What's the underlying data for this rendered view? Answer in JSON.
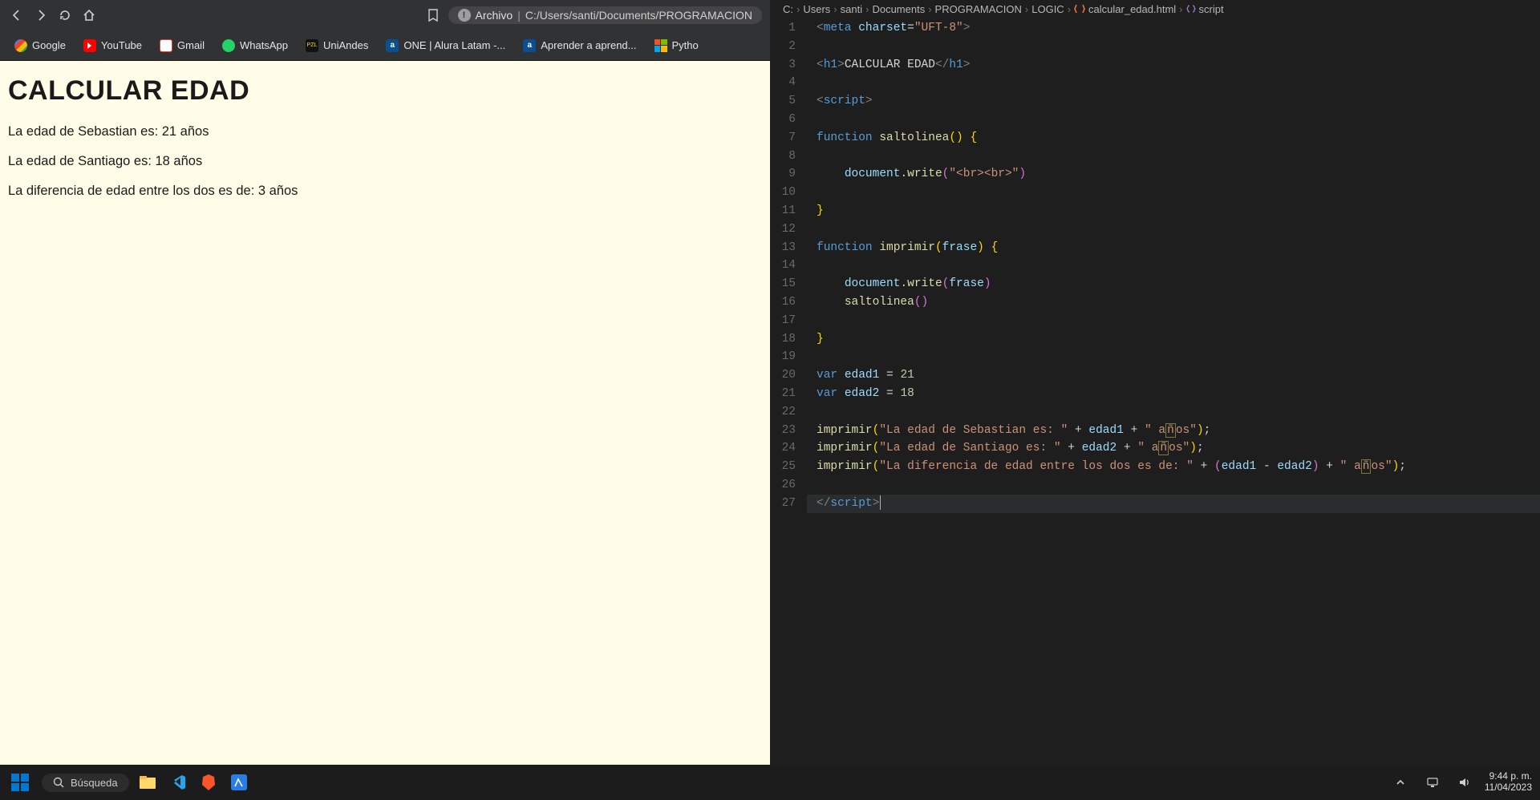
{
  "browser": {
    "url_label": "Archivo",
    "url_path": "C:/Users/santi/Documents/PROGRAMACION",
    "bookmarks": [
      {
        "label": "Google",
        "color": "#fff"
      },
      {
        "label": "YouTube",
        "color": "#ff0000"
      },
      {
        "label": "Gmail",
        "color": "#ea4335"
      },
      {
        "label": "WhatsApp",
        "color": "#25d366"
      },
      {
        "label": "UniAndes",
        "color": "#222"
      },
      {
        "label": "ONE | Alura Latam -...",
        "color": "#0a4f8f"
      },
      {
        "label": "Aprender a aprend...",
        "color": "#0a4f8f"
      },
      {
        "label": "Pytho",
        "color": "#00a4ef"
      }
    ],
    "page": {
      "h1": "CALCULAR EDAD",
      "p1": "La edad de Sebastian es: 21 años",
      "p2": "La edad de Santiago es: 18 años",
      "p3": "La diferencia de edad entre los dos es de: 3 años"
    }
  },
  "editor": {
    "breadcrumbs": [
      "C:",
      "Users",
      "santi",
      "Documents",
      "PROGRAMACION",
      "LOGIC"
    ],
    "file": "calcular_edad.html",
    "symbol": "script",
    "lines": 27
  },
  "taskbar": {
    "search": "Búsqueda",
    "time": "9:44 p. m.",
    "date": "11/04/2023"
  }
}
